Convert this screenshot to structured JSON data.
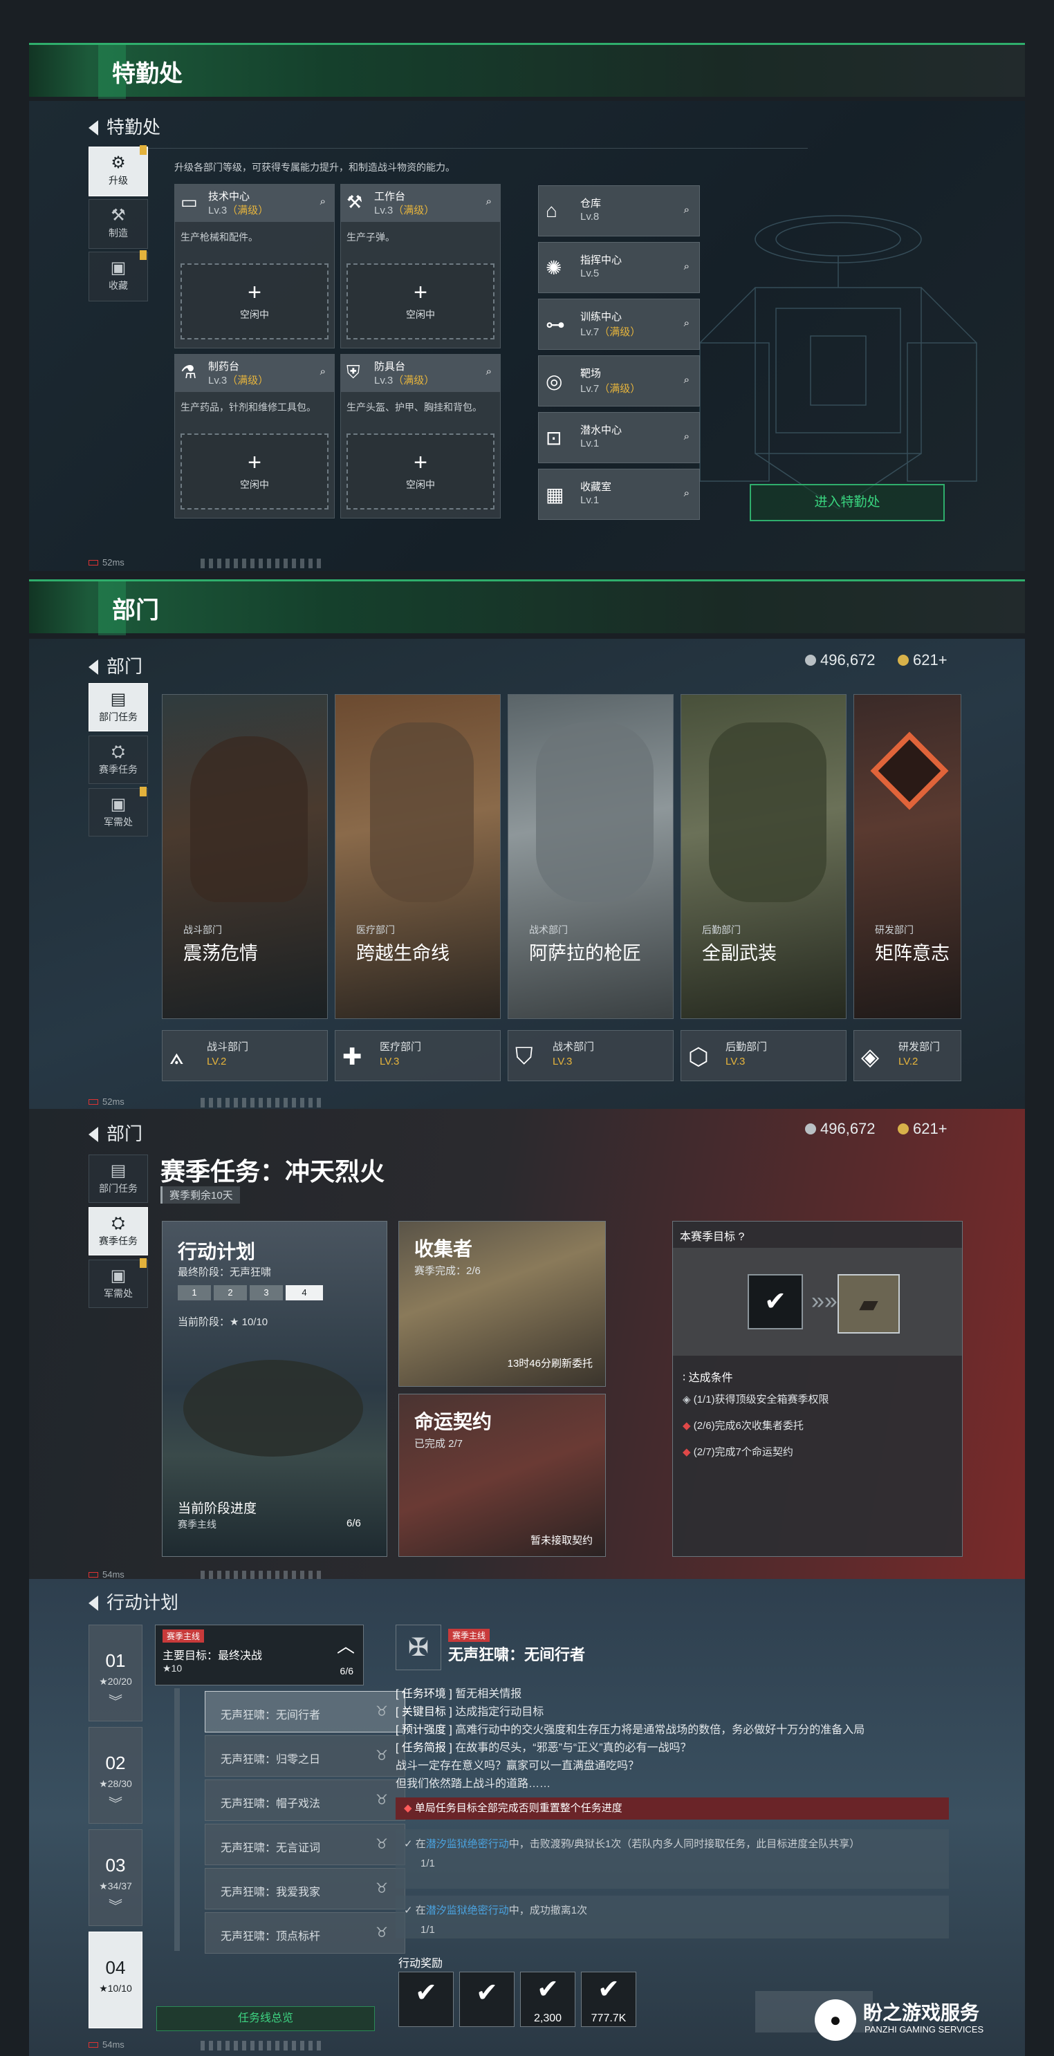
{
  "s1": {
    "title": "特勤处",
    "back": "特勤处",
    "desc": "升级各部门等级，可获得专属能力提升，和制造战斗物资的能力。",
    "side": [
      {
        "label": "升级"
      },
      {
        "label": "制造"
      },
      {
        "label": "收藏"
      }
    ],
    "cards": [
      {
        "name": "技术中心",
        "lv": "Lv.3",
        "full": "（满级）",
        "desc": "生产枪械和配件。",
        "slot": "空闲中"
      },
      {
        "name": "工作台",
        "lv": "Lv.3",
        "full": "（满级）",
        "desc": "生产子弹。",
        "slot": "空闲中"
      },
      {
        "name": "制药台",
        "lv": "Lv.3",
        "full": "（满级）",
        "desc": "生产药品，针剂和维修工具包。",
        "slot": "空闲中"
      },
      {
        "name": "防具台",
        "lv": "Lv.3",
        "full": "（满级）",
        "desc": "生产头盔、护甲、胸挂和背包。",
        "slot": "空闲中"
      }
    ],
    "minis": [
      {
        "name": "仓库",
        "lv": "Lv.8",
        "full": ""
      },
      {
        "name": "指挥中心",
        "lv": "Lv.5",
        "full": ""
      },
      {
        "name": "训练中心",
        "lv": "Lv.7",
        "full": "（满级）"
      },
      {
        "name": "靶场",
        "lv": "Lv.7",
        "full": "（满级）"
      },
      {
        "name": "潜水中心",
        "lv": "Lv.1",
        "full": ""
      },
      {
        "name": "收藏室",
        "lv": "Lv.1",
        "full": ""
      }
    ],
    "enter": "进入特勤处",
    "ping": "52ms"
  },
  "s2": {
    "title": "部门",
    "back": "部门",
    "silver": "496,672",
    "gold": "621+",
    "side": [
      {
        "label": "部门任务"
      },
      {
        "label": "赛季任务"
      },
      {
        "label": "军需处"
      }
    ],
    "depts": [
      {
        "sub": "战斗部门",
        "name": "震荡危情",
        "tag": "战斗部门",
        "lv": "LV.2"
      },
      {
        "sub": "医疗部门",
        "name": "跨越生命线",
        "tag": "医疗部门",
        "lv": "LV.3"
      },
      {
        "sub": "战术部门",
        "name": "阿萨拉的枪匠",
        "tag": "战术部门",
        "lv": "LV.3"
      },
      {
        "sub": "后勤部门",
        "name": "全副武装",
        "tag": "后勤部门",
        "lv": "LV.3"
      },
      {
        "sub": "研发部门",
        "name": "矩阵意志",
        "tag": "研发部门",
        "lv": "LV.2"
      }
    ],
    "ping": "52ms"
  },
  "s3": {
    "back": "部门",
    "silver": "496,672",
    "gold": "621+",
    "title": "赛季任务：冲天烈火",
    "remain": "赛季剩余10天",
    "side": [
      {
        "label": "部门任务"
      },
      {
        "label": "赛季任务"
      },
      {
        "label": "军需处"
      }
    ],
    "plan": {
      "title": "行动计划",
      "final": "最终阶段：无声狂啸",
      "steps": [
        "1",
        "2",
        "3",
        "4"
      ],
      "cur": "当前阶段：★ 10/10",
      "progress": "当前阶段进度",
      "sub": "赛季主线",
      "count": "6/6"
    },
    "col": {
      "title": "收集者",
      "done": "赛季完成：2/6",
      "refresh": "13时46分刷新委托"
    },
    "fate": {
      "title": "命运契约",
      "done": "已完成 2/7",
      "none": "暂未接取契约"
    },
    "goal": {
      "title": "本赛季目标",
      "q": "?",
      "cond": "达成条件",
      "items": [
        "(1/1)获得顶级安全箱赛季权限",
        "(2/6)完成6次收集者委托",
        "(2/7)完成7个命运契约"
      ]
    },
    "ping": "54ms"
  },
  "s4": {
    "back": "行动计划",
    "stages": [
      {
        "n": "01",
        "s": "★20/20"
      },
      {
        "n": "02",
        "s": "★28/30"
      },
      {
        "n": "03",
        "s": "★34/37"
      },
      {
        "n": "04",
        "s": "★10/10"
      }
    ],
    "main": {
      "tag": "赛季主线",
      "title": "主要目标：最终决战",
      "star": "★10",
      "count": "6/6"
    },
    "list": [
      "无声狂啸：无间行者",
      "无声狂啸：归零之日",
      "无声狂啸：帽子戏法",
      "无声狂啸：无言证词",
      "无声狂啸：我爱我家",
      "无声狂啸：顶点标杆"
    ],
    "overview": "任务线总览",
    "det": {
      "tag": "赛季主线",
      "title": "无声狂啸：无间行者",
      "lines": [
        {
          "k": "[ 任务环境 ]",
          "v": "暂无相关情报"
        },
        {
          "k": "[ 关键目标 ]",
          "v": "达成指定行动目标"
        },
        {
          "k": "[ 预计强度 ]",
          "v": "高难行动中的交火强度和生存压力将是通常战场的数倍，务必做好十万分的准备入局"
        },
        {
          "k": "[ 任务简报 ]",
          "v": "在故事的尽头，“邪恶”与“正义”真的必有一战吗？"
        }
      ],
      "extra1": "战斗一定存在意义吗？赢家可以一直满盘通吃吗？",
      "extra2": "但我们依然踏上战斗的道路……",
      "warn": "单局任务目标全部完成否则重置整个任务进度",
      "obj1a": "在",
      "obj1b": "潜汐监狱绝密行动",
      "obj1c": "中，击败渡鸦/典狱长1次（若队内多人同时接取任务，此目标进度全队共享）",
      "obj1p": "1/1",
      "obj2a": "在",
      "obj2b": "潜汐监狱绝密行动",
      "obj2c": "中，成功撤离1次",
      "obj2p": "1/1"
    },
    "reward": "行动奖励",
    "rw": [
      "",
      "",
      "2,300",
      "777.7K"
    ],
    "ping": "54ms"
  },
  "wm": {
    "title": "盼之游戏服务",
    "en": "PANZHI GAMING SERVICES"
  }
}
